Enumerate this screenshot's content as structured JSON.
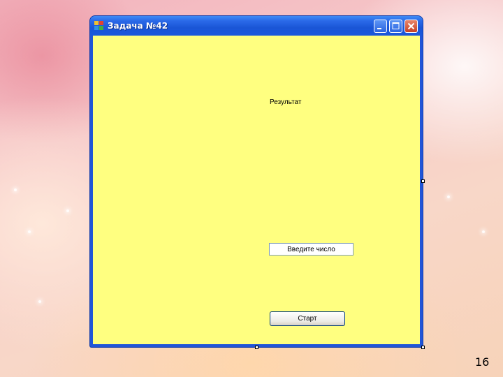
{
  "window": {
    "title": "Задача №42",
    "client_bg": "#ffff80"
  },
  "form": {
    "result_label": "Результат",
    "input_value": "Введите число",
    "start_button": "Старт"
  },
  "slide": {
    "number": "16"
  }
}
